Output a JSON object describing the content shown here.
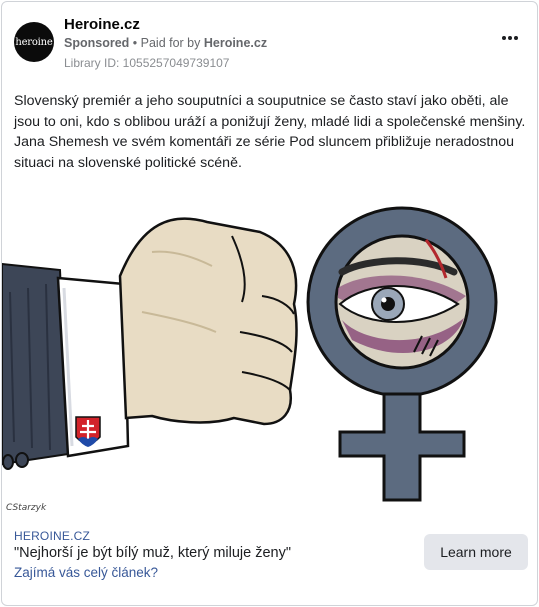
{
  "header": {
    "avatar_text": "heroine",
    "page_name": "Heroine.cz",
    "sponsored_label": "Sponsored",
    "separator": " • ",
    "paid_for_prefix": "Paid for by ",
    "paid_for_name": "Heroine.cz",
    "library_id": "Library ID: 1055257049739107"
  },
  "post": {
    "text": "Slovenský premiér a jeho souputníci a souputnice se často staví jako oběti, ale jsou to oni, kdo s oblibou uráží a ponižují ženy, mladé lidi a společenské menšiny. Jana Shemesh ve svém komentáři ze série Pod sluncem přibližuje neradostnou situaci na slovenské politické scéně."
  },
  "image": {
    "description_icons": [
      "fist",
      "slovak-emblem-cufflink",
      "female-symbol",
      "bruised-eye"
    ],
    "signature": "CStarzyk",
    "colors": {
      "fist": "#e8dcc4",
      "suit": "#3d4657",
      "symbol": "#5c6b80",
      "bruise": "#8a4f7a",
      "emblem_red": "#d2232a",
      "emblem_blue": "#1f4aa8"
    }
  },
  "link": {
    "domain": "HEROINE.CZ",
    "title": "\"Nejhorší je být bílý muž, který miluje ženy\"",
    "description": "Zajímá vás celý článek?",
    "cta_label": "Learn more"
  }
}
